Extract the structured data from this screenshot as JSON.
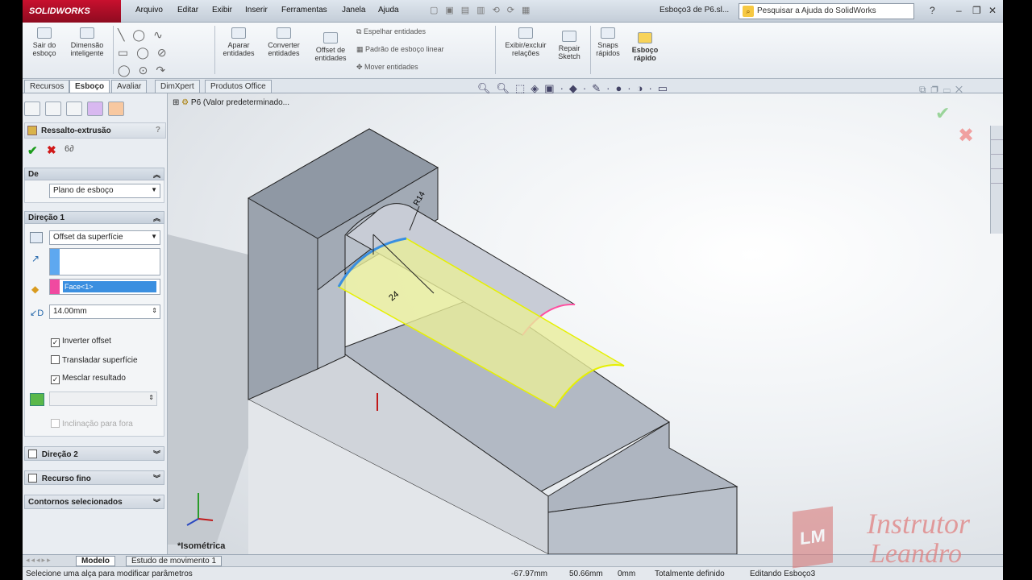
{
  "app": {
    "brand": "SOLIDWORKS",
    "document_title": "Esboço3 de P6.sl...",
    "help_placeholder": "Pesquisar a Ajuda do SolidWorks"
  },
  "menu": [
    "Arquivo",
    "Editar",
    "Exibir",
    "Inserir",
    "Ferramentas",
    "Janela",
    "Ajuda"
  ],
  "commands": {
    "sair_esboco": "Sair do esboço",
    "dimensao": "Dimensão inteligente",
    "aparar": "Aparar entidades",
    "converter": "Converter entidades",
    "offset": "Offset de entidades",
    "espelhar": "Espelhar entidades",
    "padrao": "Padrão de esboço linear",
    "mover": "Mover entidades",
    "exibir_relacoes": "Exibir/excluir relações",
    "repair": "Repair Sketch",
    "snaps": "Snaps rápidos",
    "esboco_rapido": "Esboço rápido"
  },
  "tabs": [
    "Recursos",
    "Esboço",
    "Avaliar",
    "DimXpert",
    "Produtos Office"
  ],
  "property_manager": {
    "title": "Ressalto-extrusão",
    "de_label": "De",
    "de_value": "Plano de esboço",
    "direcao1_label": "Direção 1",
    "direcao1_value": "Offset da superfície",
    "face_value": "Face<1>",
    "distance_value": "14.00mm",
    "checkboxes": [
      {
        "label": "Inverter offset",
        "checked": true
      },
      {
        "label": "Transladar superfície",
        "checked": false
      },
      {
        "label": "Mesclar resultado",
        "checked": true
      }
    ],
    "inclinacao_label": "Inclinação para fora",
    "direcao2_label": "Direção 2",
    "recurso_fino_label": "Recurso fino",
    "contornos_label": "Contornos selecionados"
  },
  "viewport": {
    "tree_crumb": "P6  (Valor predeterminado...",
    "view_label": "*Isométrica",
    "dim_radius": "R14",
    "dim_linear": "24"
  },
  "bottom_tabs": [
    "Modelo",
    "Estudo de movimento 1"
  ],
  "status": {
    "message": "Selecione uma alça para modificar parâmetros",
    "x": "-67.97mm",
    "y": "50.66mm",
    "z": "0mm",
    "state": "Totalmente definido",
    "editing": "Editando Esboço3"
  },
  "watermark": {
    "line1": "Instrutor",
    "line2": "Leandro"
  },
  "colors": {
    "accent_red": "#c8102e",
    "selection_yellow": "#e6f000",
    "selection_pink": "#ff4fa0",
    "sketch_blue": "#3a8fe0"
  }
}
